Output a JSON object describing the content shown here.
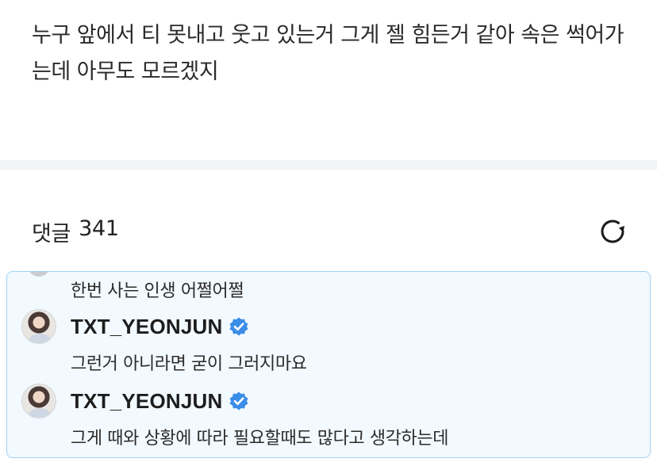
{
  "post": {
    "text": "누구 앞에서 티 못내고 웃고 있는거 그게 젤 힘든거 같아 속은 썩어가는데 아무도 모르겠지"
  },
  "comments": {
    "label": "댓글",
    "count": "341",
    "refresh_icon": "refresh-icon"
  },
  "thread": {
    "top_text": "한번 사는 인생 어쩔어쩔",
    "replies": [
      {
        "author": "TXT_YEONJUN",
        "verified": true,
        "text": "그런거 아니라면 굳이 그러지마요"
      },
      {
        "author": "TXT_YEONJUN",
        "verified": true,
        "text": "그게 때와 상황에 따라 필요할때도 많다고 생각하는데"
      }
    ],
    "accent_border": "#9fd3f5",
    "background": "#f2f9ff",
    "verified_color": "#3b8ee8"
  }
}
